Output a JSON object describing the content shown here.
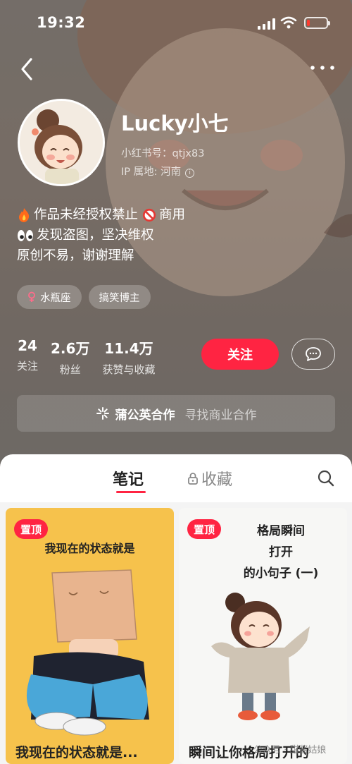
{
  "status_bar": {
    "time": "19:32",
    "battery_level": 0.15,
    "battery_color": "#ff3b30"
  },
  "profile": {
    "name": "Lucky小七",
    "xhs_id": "小红书号：qtjx83",
    "ip_location": "IP 属地: 河南",
    "bio": [
      "作品未经授权禁止",
      "商用",
      "发现盗图，坚决维权",
      "原创不易，谢谢理解"
    ],
    "tags": [
      "水瓶座",
      "搞笑博主"
    ],
    "stats": [
      {
        "value": "24",
        "label": "关注"
      },
      {
        "value": "2.6万",
        "label": "粉丝"
      },
      {
        "value": "11.4万",
        "label": "获赞与收藏"
      }
    ],
    "follow_label": "关注"
  },
  "business": {
    "title": "蒲公英合作",
    "subtitle": "寻找商业合作"
  },
  "tabs": {
    "notes": "笔记",
    "favorites": "收藏"
  },
  "cards": [
    {
      "pin": "置顶",
      "headline": "我现在的状态就是",
      "caption": "我现在的状态就是..."
    },
    {
      "pin": "置顶",
      "headline_lines": [
        "格局瞬间",
        "打开",
        "的小句子 (一)"
      ],
      "caption": "瞬间让你格局打开的"
    }
  ],
  "watermark": "公众号 · 甜酱姑娘",
  "colors": {
    "accent": "#ff2442",
    "card1_bg": "#f6c24c"
  }
}
